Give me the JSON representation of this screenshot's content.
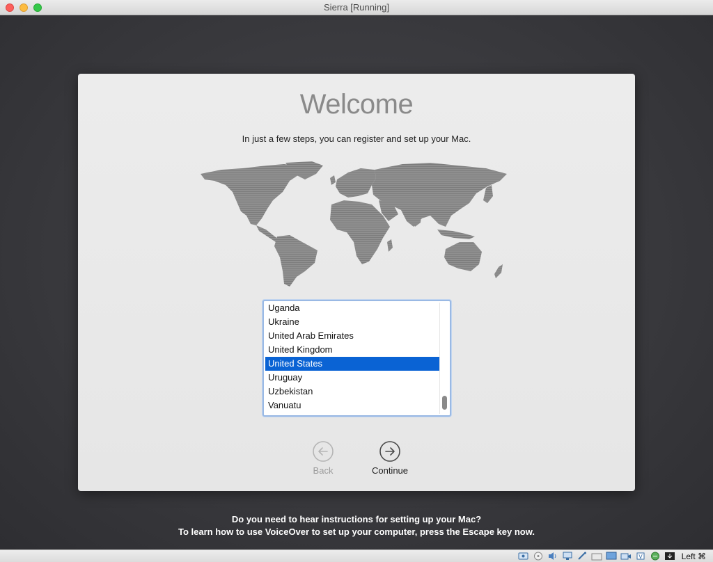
{
  "window": {
    "title": "Sierra [Running]"
  },
  "welcome": {
    "heading": "Welcome",
    "subtitle": "In just a few steps, you can register and set up your Mac."
  },
  "country_list": {
    "items": [
      "Uganda",
      "Ukraine",
      "United Arab Emirates",
      "United Kingdom",
      "United States",
      "Uruguay",
      "Uzbekistan",
      "Vanuatu"
    ],
    "selected": "United States"
  },
  "nav": {
    "back_label": "Back",
    "continue_label": "Continue"
  },
  "voiceover": {
    "line1": "Do you need to hear instructions for setting up your Mac?",
    "line2": "To learn how to use VoiceOver to set up your computer, press the Escape key now."
  },
  "statusbar": {
    "icons": [
      "hard-disk-icon",
      "optical-drive-icon",
      "audio-icon",
      "network-icon",
      "usb-icon",
      "shared-folders-icon",
      "display-icon",
      "video-capture-icon",
      "cpu-icon",
      "mouse-integration-icon",
      "host-key-arrow-icon"
    ],
    "host_key": "Left ⌘"
  },
  "colors": {
    "selection": "#0a63d4",
    "focus_ring": "#9ab9e4",
    "desktop": "#3a3a3e"
  }
}
